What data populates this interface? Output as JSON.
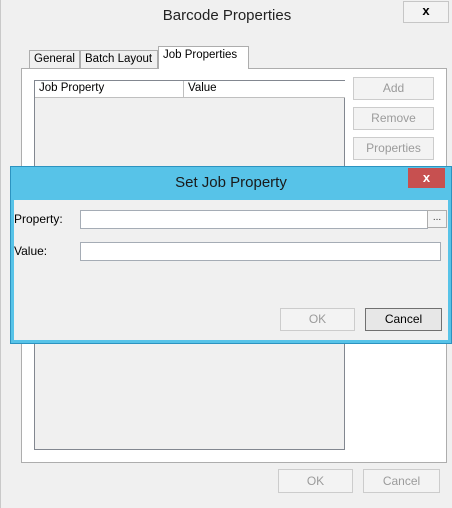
{
  "main_window": {
    "title": "Barcode Properties",
    "close_glyph": "x",
    "tabs": [
      {
        "label": "General",
        "selected": false
      },
      {
        "label": "Batch Layout",
        "selected": false
      },
      {
        "label": "Job Properties",
        "selected": true
      }
    ],
    "list": {
      "columns": [
        "Job Property",
        "Value"
      ]
    },
    "side_buttons": {
      "add": "Add",
      "remove": "Remove",
      "properties": "Properties"
    },
    "footer_buttons": {
      "ok": "OK",
      "cancel": "Cancel"
    }
  },
  "dialog": {
    "title": "Set Job Property",
    "close_glyph": "x",
    "property_label": "Property:",
    "property_value": "",
    "browse_label": "...",
    "value_label": "Value:",
    "value_value": "",
    "ok": "OK",
    "cancel": "Cancel"
  },
  "colors": {
    "dialog_frame": "#57c3e8",
    "close_red": "#c75050"
  }
}
